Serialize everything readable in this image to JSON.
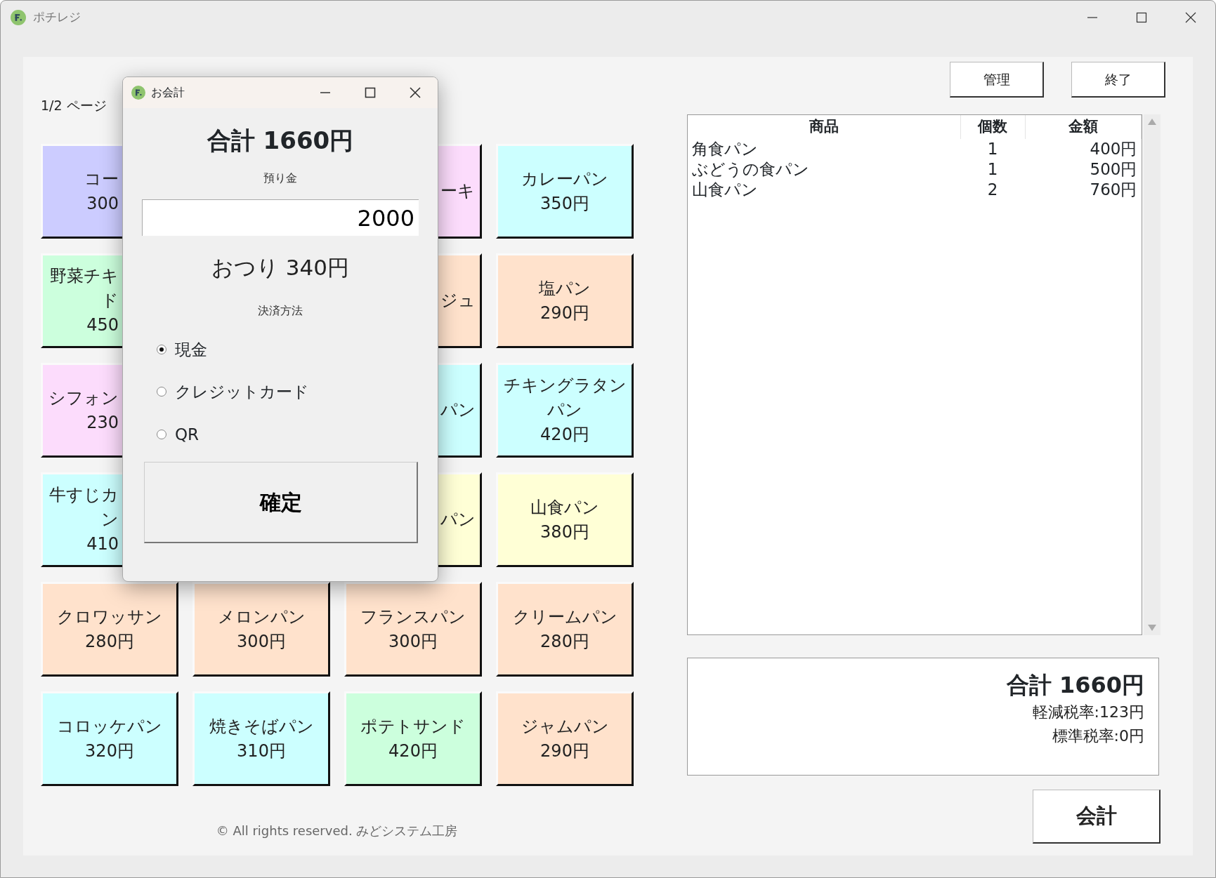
{
  "window": {
    "title": "ポチレジ"
  },
  "page_label": "1/2 ページ",
  "product_rows": [
    [
      {
        "kind": "cut_right",
        "color": "#ccccff",
        "lines": [
          "コー",
          "300"
        ]
      },
      {
        "kind": "hidden"
      },
      {
        "kind": "cut_left",
        "color": "#fcdcfc",
        "lines": [
          "ーキ"
        ]
      },
      {
        "kind": "full",
        "color": "#ccffff",
        "lines": [
          "カレーパン",
          "350円"
        ]
      }
    ],
    [
      {
        "kind": "cut_right",
        "color": "#ccffdd",
        "lines": [
          "野菜チキ",
          "ド",
          "450"
        ]
      },
      {
        "kind": "hidden"
      },
      {
        "kind": "cut_left",
        "color": "#ffe2cc",
        "lines": [
          "ジュ"
        ]
      },
      {
        "kind": "full",
        "color": "#ffe2cc",
        "lines": [
          "塩パン",
          "290円"
        ]
      }
    ],
    [
      {
        "kind": "cut_right",
        "color": "#fcdcfc",
        "lines": [
          "シフォン",
          "230"
        ]
      },
      {
        "kind": "hidden"
      },
      {
        "kind": "cut_left",
        "color": "#ccffff",
        "lines": [
          "パン"
        ]
      },
      {
        "kind": "full",
        "color": "#ccffff",
        "lines": [
          "チキングラタン",
          "パン",
          "420円"
        ]
      }
    ],
    [
      {
        "kind": "cut_right",
        "color": "#ccffff",
        "lines": [
          "牛すじカ",
          "ン",
          "410"
        ]
      },
      {
        "kind": "hidden"
      },
      {
        "kind": "cut_left",
        "color": "#ffffd6",
        "lines": [
          "パン"
        ]
      },
      {
        "kind": "full",
        "color": "#ffffd6",
        "lines": [
          "山食パン",
          "380円"
        ]
      }
    ],
    [
      {
        "kind": "full",
        "color": "#ffe2cc",
        "lines": [
          "クロワッサン",
          "280円"
        ]
      },
      {
        "kind": "full",
        "color": "#ffe2cc",
        "lines": [
          "メロンパン",
          "300円"
        ]
      },
      {
        "kind": "full",
        "color": "#ffe2cc",
        "lines": [
          "フランスパン",
          "300円"
        ]
      },
      {
        "kind": "full",
        "color": "#ffe2cc",
        "lines": [
          "クリームパン",
          "280円"
        ]
      }
    ],
    [
      {
        "kind": "full",
        "color": "#ccffff",
        "lines": [
          "コロッケパン",
          "320円"
        ]
      },
      {
        "kind": "full",
        "color": "#ccffff",
        "lines": [
          "焼きそばパン",
          "310円"
        ]
      },
      {
        "kind": "full",
        "color": "#ccffdd",
        "lines": [
          "ポテトサンド",
          "420円"
        ]
      },
      {
        "kind": "full",
        "color": "#ffe2cc",
        "lines": [
          "ジャムパン",
          "290円"
        ]
      }
    ]
  ],
  "footer": "© All rights reserved. みどシステム工房",
  "top_buttons": [
    "管理",
    "終了"
  ],
  "order_table": {
    "columns": [
      "商品",
      "個数",
      "金額"
    ],
    "rows": [
      {
        "name": "角食パン",
        "qty": "1",
        "amount": "400円"
      },
      {
        "name": "ぶどうの食パン",
        "qty": "1",
        "amount": "500円"
      },
      {
        "name": "山食パン",
        "qty": "2",
        "amount": "760円"
      }
    ]
  },
  "totals": {
    "total": "合計 1660円",
    "reduced_tax": "軽減税率:123円",
    "standard_tax": "標準税率:0円"
  },
  "checkout_button": "会計",
  "dialog": {
    "title": "お会計",
    "total": "合計 1660円",
    "deposit_label": "預り金",
    "deposit_value": "2000",
    "change": "おつり 340円",
    "payment_label": "決済方法",
    "payment_methods": [
      {
        "label": "現金",
        "selected": true
      },
      {
        "label": "クレジットカード",
        "selected": false
      },
      {
        "label": "QR",
        "selected": false
      }
    ],
    "confirm_button": "確定"
  }
}
